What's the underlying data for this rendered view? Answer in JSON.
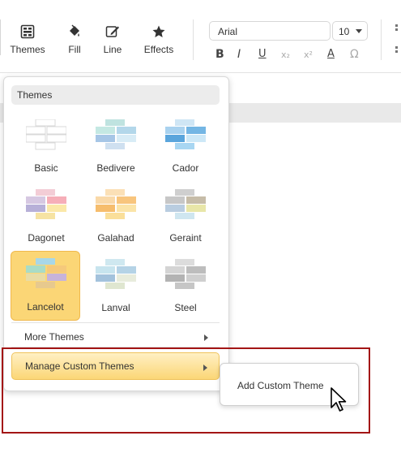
{
  "toolbar": {
    "tools": [
      {
        "label": "Themes",
        "icon": "themes-icon"
      },
      {
        "label": "Fill",
        "icon": "fill-bucket-icon"
      },
      {
        "label": "Line",
        "icon": "pen-line-icon"
      },
      {
        "label": "Effects",
        "icon": "star-icon"
      }
    ],
    "font_family": "Arial",
    "font_size": "10",
    "format_buttons": [
      {
        "label": "B",
        "name": "bold-button"
      },
      {
        "label": "I",
        "name": "italic-button"
      },
      {
        "label": "U",
        "name": "underline-button"
      },
      {
        "label": "x₂",
        "name": "subscript-button"
      },
      {
        "label": "x²",
        "name": "superscript-button"
      },
      {
        "label": "A",
        "name": "font-color-button"
      },
      {
        "label": "Ω",
        "name": "special-character-button"
      }
    ]
  },
  "themes_panel": {
    "header": "Themes",
    "themes": [
      {
        "label": "Basic",
        "colors": [
          "#ffffff",
          "#ffffff",
          "#ffffff",
          "#ffffff",
          "#ffffff",
          "#ffffff"
        ],
        "stroke": "#d9d9d9",
        "selected": false
      },
      {
        "label": "Bedivere",
        "colors": [
          "#bfe3e0",
          "#c4e8e3",
          "#b3d7ea",
          "#a6c6e6",
          "#d8ecf6",
          "#cfe0f0"
        ],
        "stroke": "none",
        "selected": false
      },
      {
        "label": "Cador",
        "colors": [
          "#cfe6f5",
          "#a9d2ef",
          "#74b6e4",
          "#5aa5dc",
          "#cde8f7",
          "#a8d6f2"
        ],
        "stroke": "none",
        "selected": false
      },
      {
        "label": "Dagonet",
        "colors": [
          "#f3cdd6",
          "#d6c8e2",
          "#f6aeb8",
          "#b7b0d8",
          "#fbe8a8",
          "#f6e3a3"
        ],
        "stroke": "none",
        "selected": false
      },
      {
        "label": "Galahad",
        "colors": [
          "#fbe0b6",
          "#f9d9a9",
          "#f8c57d",
          "#f6bd6d",
          "#fbe4a8",
          "#fadf9a"
        ],
        "stroke": "none",
        "selected": false
      },
      {
        "label": "Geraint",
        "colors": [
          "#cfcfcf",
          "#c7c7c7",
          "#c6bca8",
          "#b9cde0",
          "#e8e6a8",
          "#cfe6f0"
        ],
        "stroke": "none",
        "selected": false
      },
      {
        "label": "Lancelot",
        "colors": [
          "#a8d7e8",
          "#a9dcc7",
          "#f5c97b",
          "#e8dca6",
          "#c7b3da",
          "#e7c98e"
        ],
        "stroke": "none",
        "selected": true
      },
      {
        "label": "Lanval",
        "colors": [
          "#cfe8f0",
          "#c7e4ee",
          "#b5d3e6",
          "#a3c2dc",
          "#e8ecdc",
          "#dfe6d0"
        ],
        "stroke": "none",
        "selected": false
      },
      {
        "label": "Steel",
        "colors": [
          "#dcdcdc",
          "#d4d4d4",
          "#bdbdbd",
          "#b3b3b3",
          "#cfcfcf",
          "#c6c6c6"
        ],
        "stroke": "none",
        "selected": false
      }
    ],
    "more_themes": "More Themes",
    "manage_custom_themes": "Manage Custom Themes"
  },
  "submenu": {
    "add_custom_theme": "Add Custom Theme"
  }
}
